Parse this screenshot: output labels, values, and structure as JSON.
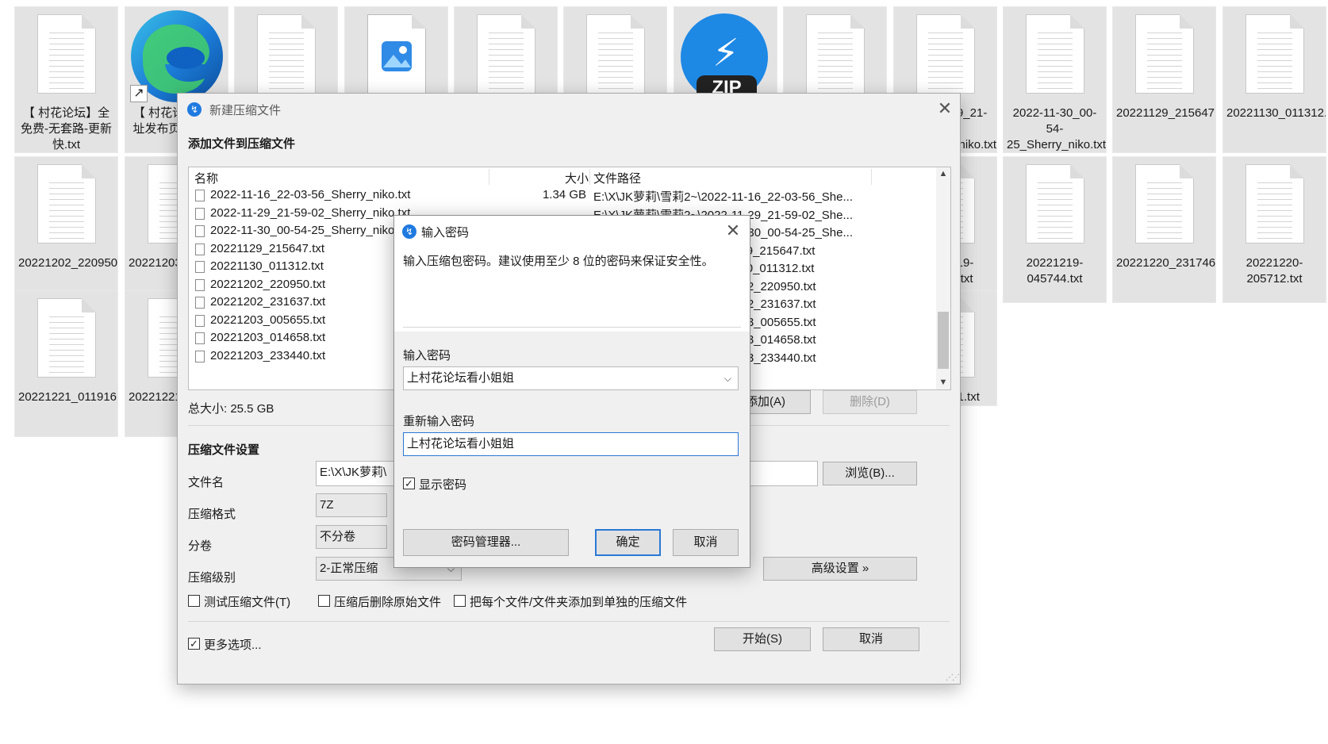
{
  "desktop": {
    "row1": [
      {
        "label": "【 村花论坛】全免费-无套路-更新快.txt",
        "type": "doc"
      },
      {
        "label": "【 村花论坛】地址发布页-此打开",
        "type": "edge"
      },
      {
        "label": "",
        "type": "doc"
      },
      {
        "label": "",
        "type": "photos"
      },
      {
        "label": "",
        "type": "doc"
      },
      {
        "label": "",
        "type": "doc"
      },
      {
        "label": "",
        "type": "zip"
      },
      {
        "label": "",
        "type": "doc"
      },
      {
        "label": "2022-11-29_21-59-02_Sherry_niko.txt",
        "type": "doc"
      },
      {
        "label": "2022-11-30_00-54-25_Sherry_niko.txt",
        "type": "doc"
      },
      {
        "label": "20221129_215647.txt",
        "type": "doc"
      },
      {
        "label": "20221130_011312.txt",
        "type": "doc"
      }
    ],
    "row2": [
      {
        "label": "20221202_220950.txt"
      },
      {
        "label": "20221203_005655.txt"
      },
      {
        "label": "20221219-190656.txt"
      },
      {
        "label": "20221219-045744.txt"
      },
      {
        "label": "20221220_231746.txt"
      },
      {
        "label": "20221220-205712.txt"
      }
    ],
    "row3": [
      {
        "label": "20221221_011916.txt"
      },
      {
        "label": "20221221_0119.txt"
      },
      {
        "label": "20221221.txt"
      }
    ],
    "zip_badge": "ZIP"
  },
  "archive_dialog": {
    "title": "新建压缩文件",
    "close_glyph": "✕",
    "heading": "添加文件到压缩文件",
    "columns": {
      "name": "名称",
      "size": "大小",
      "path": "文件路径"
    },
    "files": [
      {
        "name": "2022-11-16_22-03-56_Sherry_niko.txt",
        "size": "1.34 GB",
        "path": "E:\\X\\JK萝莉\\雪莉2~\\2022-11-16_22-03-56_She..."
      },
      {
        "name": "2022-11-29_21-59-02_Sherry_niko.txt",
        "size": "",
        "path": "E:\\X\\JK萝莉\\雪莉2~\\2022-11-29_21-59-02_She..."
      },
      {
        "name": "2022-11-30_00-54-25_Sherry_niko.txt",
        "size": "",
        "path": "E:\\X\\JK萝莉\\雪莉2~\\2022-11-30_00-54-25_She..."
      },
      {
        "name": "20221129_215647.txt",
        "size": "",
        "path": "E:\\X\\JK萝莉\\雪莉2~\\20221129_215647.txt"
      },
      {
        "name": "20221130_011312.txt",
        "size": "",
        "path": "E:\\X\\JK萝莉\\雪莉2~\\20221130_011312.txt"
      },
      {
        "name": "20221202_220950.txt",
        "size": "",
        "path": "E:\\X\\JK萝莉\\雪莉2~\\20221202_220950.txt"
      },
      {
        "name": "20221202_231637.txt",
        "size": "",
        "path": "E:\\X\\JK萝莉\\雪莉2~\\20221202_231637.txt"
      },
      {
        "name": "20221203_005655.txt",
        "size": "",
        "path": "E:\\X\\JK萝莉\\雪莉2~\\20221203_005655.txt"
      },
      {
        "name": "20221203_014658.txt",
        "size": "",
        "path": "E:\\X\\JK萝莉\\雪莉2~\\20221203_014658.txt"
      },
      {
        "name": "20221203_233440.txt",
        "size": "",
        "path": "E:\\X\\JK萝莉\\雪莉2~\\20221203_233440.txt"
      }
    ],
    "visible_paths": [
      "E:\\X\\JK萝莉\\雪莉2~\\2022-11-16_22-03-56_She...",
      "1-29_21-59-02_She...",
      "1-30_00-54-25_She...",
      "29_215647.txt",
      "30_011312.txt",
      "202_220950.txt",
      "202_231637.txt",
      "203_005655.txt",
      "203_014658.txt",
      "203_233440.txt"
    ],
    "total_size": "总大小: 25.5 GB",
    "add_button": "添加(A)",
    "delete_button": "删除(D)",
    "settings_heading": "压缩文件设置",
    "filename_label": "文件名",
    "filename_value": "E:\\X\\JK萝莉\\",
    "browse_button": "浏览(B)...",
    "format_label": "压缩格式",
    "format_value": "7Z",
    "split_label": "分卷",
    "split_value": "不分卷",
    "level_label": "压缩级别",
    "level_value": "2-正常压缩",
    "advanced_button": "高级设置 »",
    "test_checkbox": "测试压缩文件(T)",
    "delete_source_checkbox": "压缩后删除原始文件",
    "separate_checkbox": "把每个文件/文件夹添加到单独的压缩文件",
    "more_options_checkbox": "更多选项...",
    "start_button": "开始(S)",
    "cancel_button": "取消",
    "checks": {
      "test": false,
      "delete_source": false,
      "separate": false,
      "more_options": true
    }
  },
  "password_dialog": {
    "title": "输入密码",
    "close_glyph": "✕",
    "description": "输入压缩包密码。建议使用至少 8 位的密码来保证安全性。",
    "password_label": "输入密码",
    "password_value": "上村花论坛看小姐姐",
    "reenter_label": "重新输入密码",
    "reenter_value": "上村花论坛看小姐姐",
    "show_password_label": "显示密码",
    "show_password_checked": true,
    "manager_button": "密码管理器...",
    "ok_button": "确定",
    "cancel_button": "取消"
  },
  "colors": {
    "accent": "#2a78d4",
    "app_icon": "#1f7ae0",
    "tile_bg": "#e3e3e3"
  }
}
